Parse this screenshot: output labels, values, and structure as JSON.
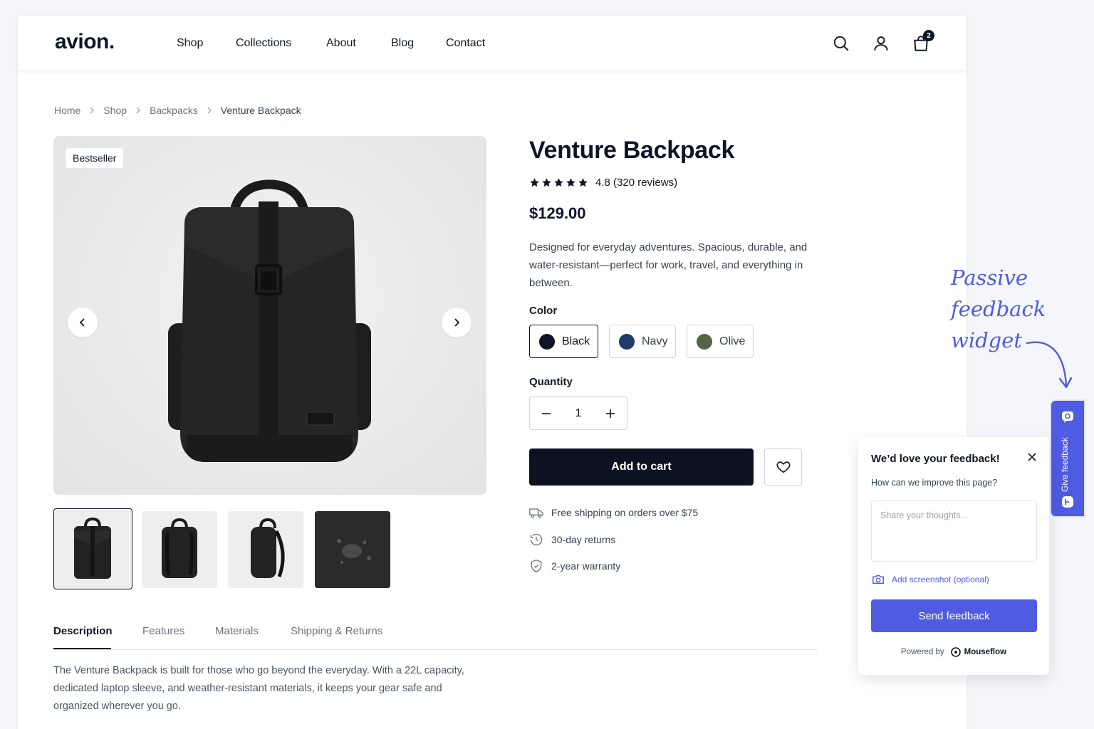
{
  "header": {
    "logo": "avion.",
    "nav": [
      "Shop",
      "Collections",
      "About",
      "Blog",
      "Contact"
    ],
    "cart_count": "2"
  },
  "breadcrumb": [
    "Home",
    "Shop",
    "Backpacks",
    "Venture Backpack"
  ],
  "gallery": {
    "badge": "Bestseller",
    "thumbnails": [
      "front",
      "back",
      "side",
      "fabric"
    ],
    "active_thumbnail": 0
  },
  "product": {
    "title": "Venture Backpack",
    "rating": "4.8",
    "reviews": "(320 reviews)",
    "stars": 5,
    "price": "$129.00",
    "description": "Designed for everyday adventures. Spacious, durable, and water-resistant—perfect for work, travel, and everything in between.",
    "color_label": "Color",
    "colors": [
      {
        "name": "Black",
        "hex": "#0e1526",
        "selected": true
      },
      {
        "name": "Navy",
        "hex": "#1f3a68",
        "selected": false
      },
      {
        "name": "Olive",
        "hex": "#56644a",
        "selected": false
      }
    ],
    "quantity_label": "Quantity",
    "quantity": "1",
    "add_to_cart": "Add to cart",
    "perks": [
      "Free shipping on orders over $75",
      "30-day returns",
      "2-year warranty"
    ]
  },
  "tabs": {
    "items": [
      "Description",
      "Features",
      "Materials",
      "Shipping & Returns"
    ],
    "active": "Description",
    "description_text": "The Venture Backpack is built for those who go beyond the everyday. With a 22L capacity, dedicated laptop sleeve, and weather-resistant materials, it keeps your gear safe and organized wherever you go."
  },
  "annotation": {
    "lines": [
      "Passive",
      "feedback",
      "widget"
    ]
  },
  "feedback": {
    "tab_label": "Give feedback",
    "title": "We’d love your feedback!",
    "subtitle": "How can we improve this page?",
    "placeholder": "Share your thoughts...",
    "screenshot_label": "Add screenshot (optional)",
    "send_label": "Send feedback",
    "powered_by": "Powered by",
    "brand": "Mouseflow",
    "accent": "#4f5be0"
  }
}
